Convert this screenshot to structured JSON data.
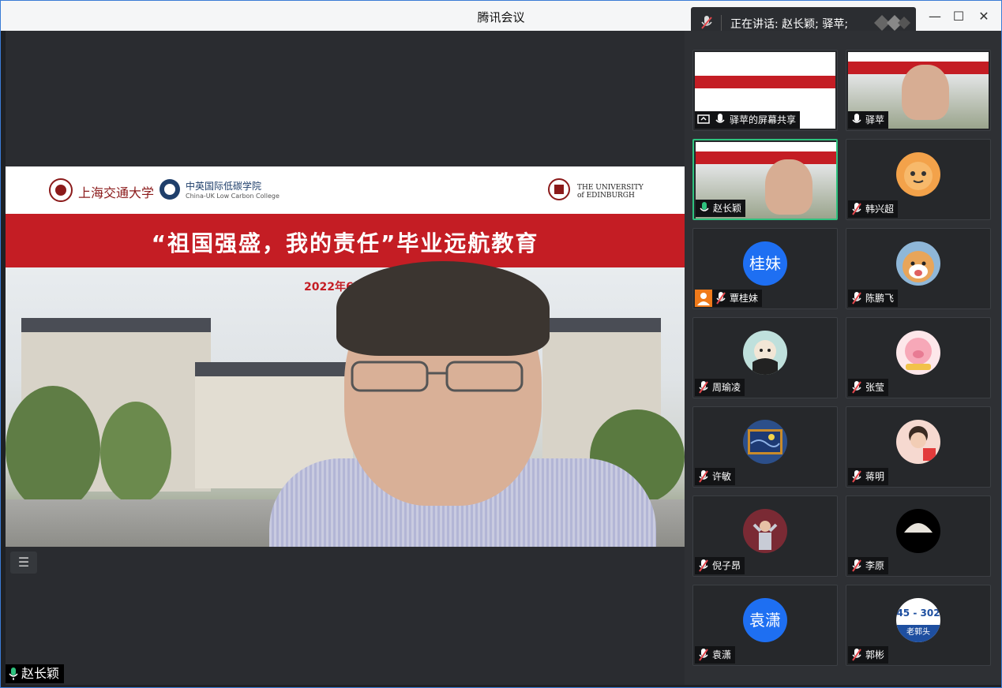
{
  "window": {
    "title": "腾讯会议"
  },
  "speaking": {
    "text": "正在讲话: 赵长颖; 驿苹;"
  },
  "main": {
    "speaker_name": "赵长颖",
    "slide": {
      "logo_left": "上海交通大学",
      "logo_middle": "中英国际低碳学院",
      "logo_middle_sub": "China-UK Low Carbon College",
      "logo_right": "THE UNIVERSITY of EDINBURGH",
      "title": "“祖国强盛，我的责任”毕业远航教育",
      "date": "2022年6月25日"
    }
  },
  "participants": [
    {
      "name": "驿苹的屏幕共享",
      "type": "screen",
      "mic": "on"
    },
    {
      "name": "驿苹",
      "type": "video",
      "mic": "on"
    },
    {
      "name": "赵长颖",
      "type": "video",
      "mic": "on",
      "active": true
    },
    {
      "name": "韩兴超",
      "type": "avatar",
      "avatar": "tiger",
      "mic": "off"
    },
    {
      "name": "覃桂妹",
      "type": "text-avatar",
      "avatar_text": "桂妹",
      "mic": "off",
      "host": true
    },
    {
      "name": "陈鹏飞",
      "type": "avatar",
      "avatar": "dog",
      "mic": "off"
    },
    {
      "name": "周瑜凌",
      "type": "avatar",
      "avatar": "cartoon",
      "mic": "off"
    },
    {
      "name": "张莹",
      "type": "avatar",
      "avatar": "pig",
      "mic": "off"
    },
    {
      "name": "许敏",
      "type": "avatar",
      "avatar": "starry-night",
      "mic": "off"
    },
    {
      "name": "蒋明",
      "type": "avatar",
      "avatar": "girl",
      "mic": "off"
    },
    {
      "name": "倪子昂",
      "type": "avatar",
      "avatar": "crowd",
      "mic": "off"
    },
    {
      "name": "李原",
      "type": "avatar",
      "avatar": "moon",
      "mic": "off"
    },
    {
      "name": "袁潇",
      "type": "text-avatar",
      "avatar_text": "袁潇",
      "mic": "off"
    },
    {
      "name": "郭彬",
      "type": "avatar",
      "avatar": "badge",
      "avatar_text": "45 - 302",
      "avatar_sub": "老郭头",
      "mic": "off"
    }
  ],
  "colors": {
    "accent": "#1e6ff2",
    "active_border": "#2ec27e",
    "banner": "#c41d24"
  }
}
